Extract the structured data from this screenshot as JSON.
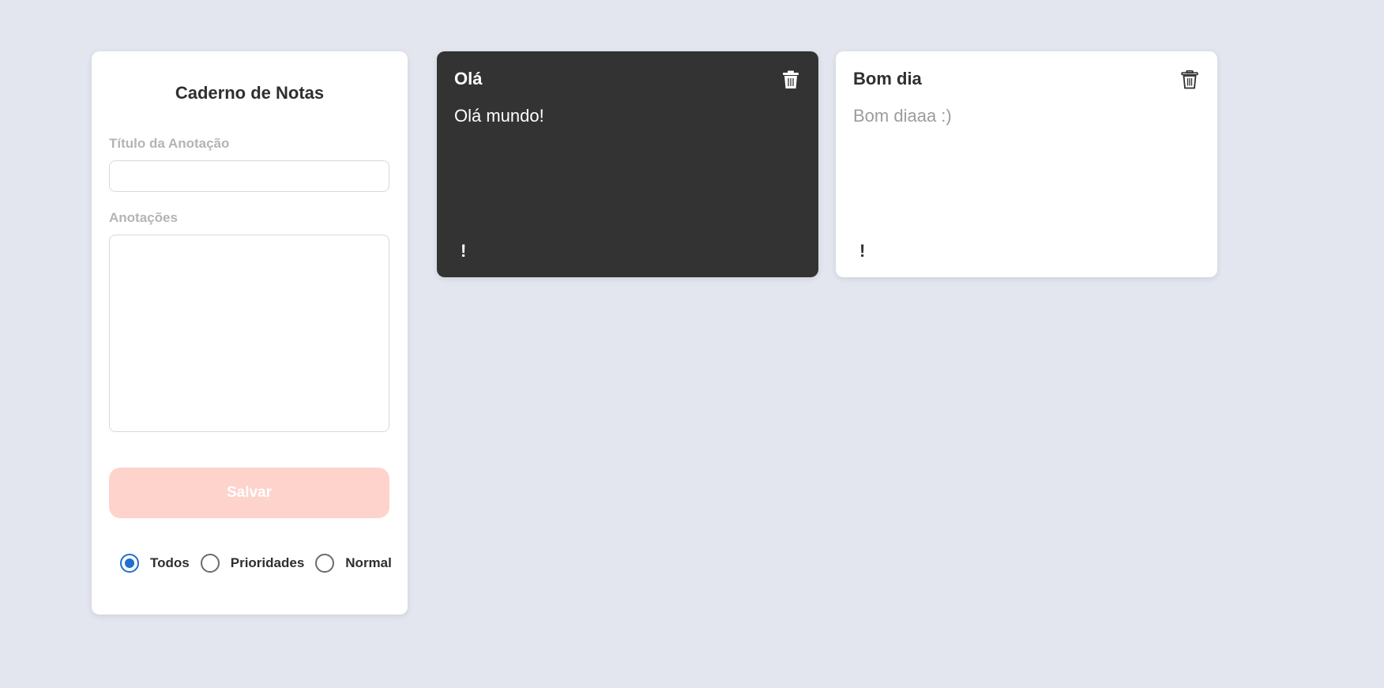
{
  "form": {
    "title": "Caderno de Notas",
    "title_label": "Título da Anotação",
    "title_value": "",
    "notes_label": "Anotações",
    "notes_value": "",
    "save_label": "Salvar",
    "save_color": "#fed3cc",
    "filters": [
      {
        "label": "Todos",
        "checked": true
      },
      {
        "label": "Prioridades",
        "checked": false
      },
      {
        "label": "Normal",
        "checked": false
      }
    ]
  },
  "notes": [
    {
      "title": "Olá",
      "body": "Olá mundo!",
      "priority_mark": "!",
      "theme": "dark",
      "bg": "#333333",
      "icon": "trash-icon"
    },
    {
      "title": "Bom dia",
      "body": "Bom diaaa :)",
      "priority_mark": "!",
      "theme": "light",
      "bg": "#ffffff",
      "icon": "trash-icon"
    }
  ],
  "colors": {
    "background": "#e3e6ef",
    "accent": "#1f6fd0"
  }
}
